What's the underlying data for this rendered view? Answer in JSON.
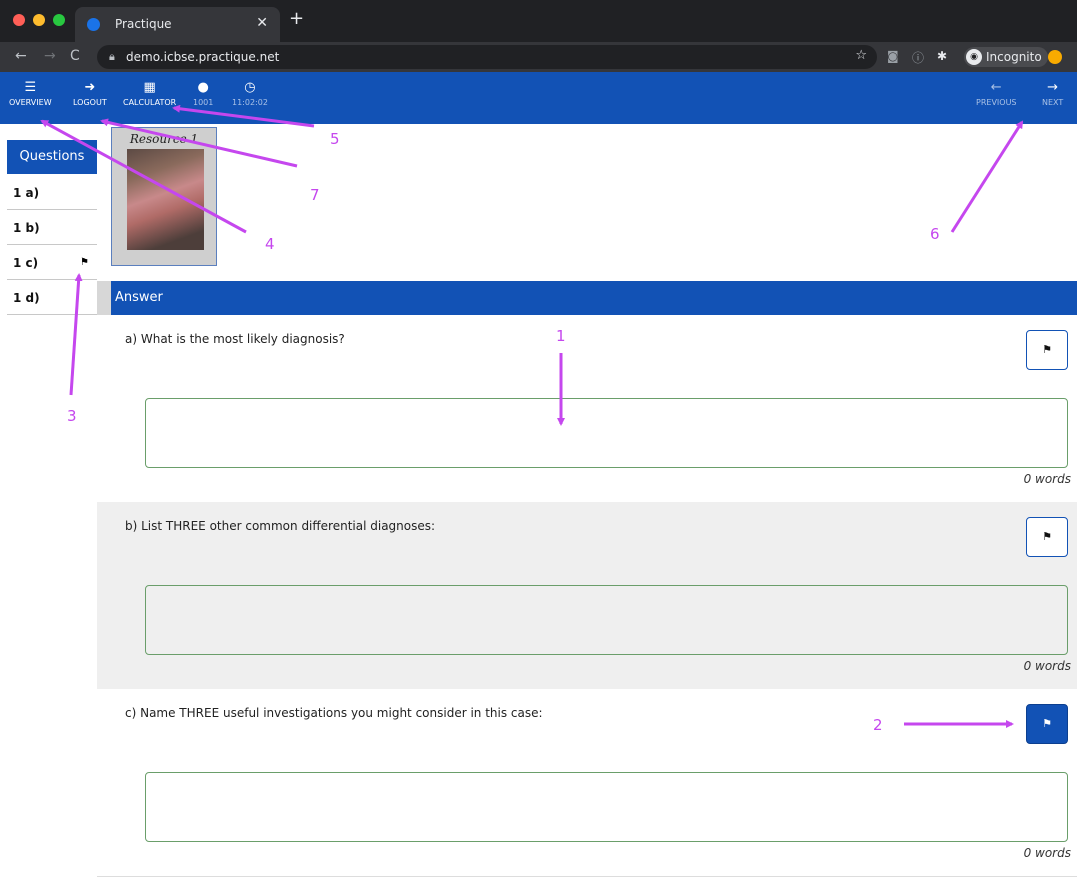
{
  "browser": {
    "tab_title": "Practique",
    "url": "demo.icbse.practique.net",
    "profile_label": "Incognito",
    "icons": [
      "back-icon",
      "forward-icon",
      "reload-icon",
      "lock-icon",
      "star-icon",
      "camera-icon",
      "info-icon",
      "extensions-icon",
      "incognito-icon"
    ]
  },
  "toolbar": {
    "overview": "OVERVIEW",
    "logout": "LOGOUT",
    "calculator": "CALCULATOR",
    "user_id": "1001",
    "time": "11:02:02",
    "previous": "PREVIOUS",
    "next": "NEXT"
  },
  "sidebar": {
    "header": "Questions",
    "items": [
      {
        "label": "1 a)",
        "flagged": false
      },
      {
        "label": "1 b)",
        "flagged": false
      },
      {
        "label": "1 c)",
        "flagged": true
      },
      {
        "label": "1 d)",
        "flagged": false
      }
    ]
  },
  "resource": {
    "label": "Resource 1"
  },
  "answer": {
    "header": "Answer",
    "questions": [
      {
        "text": "a)  What is the most likely diagnosis?",
        "word_count": "0 words",
        "flag_active": false
      },
      {
        "text": "b)  List THREE other common differential diagnoses:",
        "word_count": "0 words",
        "flag_active": false
      },
      {
        "text": "c)  Name THREE useful investigations you might consider in this case:",
        "word_count": "0 words",
        "flag_active": true
      }
    ]
  },
  "annotations": [
    "1",
    "2",
    "3",
    "4",
    "5",
    "6",
    "7"
  ],
  "colors": {
    "brand_blue": "#1252b5",
    "annotation": "#c547ee",
    "answer_border": "#6a9e6a"
  }
}
